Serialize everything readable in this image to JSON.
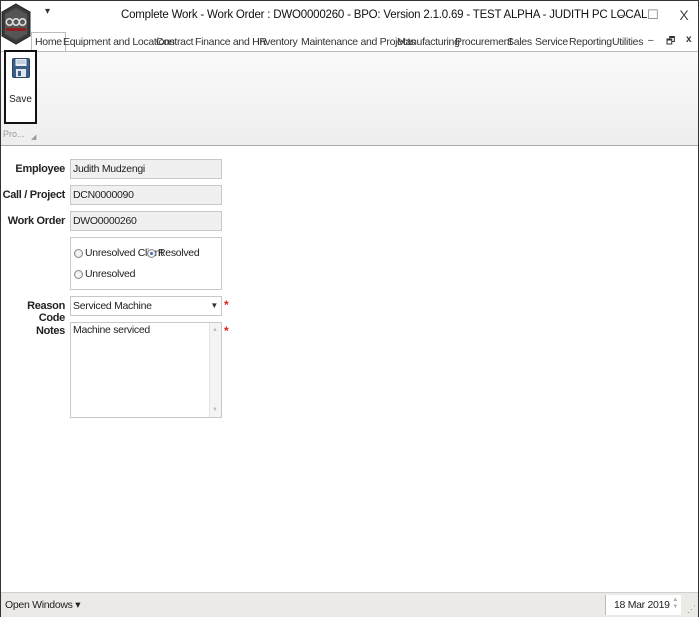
{
  "window": {
    "title": "Complete Work - Work Order : DWO0000260 - BPO: Version 2.1.0.69 - TEST ALPHA - JUDITH PC LOCAL",
    "quick_access": "▾",
    "minimize": "–",
    "restore": "☐",
    "close": "X"
  },
  "ribbon": {
    "tabs": [
      {
        "label": "Home",
        "active": true
      },
      {
        "label": "Equipment and Locations"
      },
      {
        "label": "Contract"
      },
      {
        "label": "Finance and HR"
      },
      {
        "label": "Inventory"
      },
      {
        "label": "Maintenance and Projects"
      },
      {
        "label": "Manufacturing"
      },
      {
        "label": "Procurement"
      },
      {
        "label": "Sales"
      },
      {
        "label": "Service"
      },
      {
        "label": "Reporting"
      },
      {
        "label": "Utilities"
      }
    ],
    "tab_controls": {
      "minimize": "–",
      "restore": "🗗",
      "close": "x"
    },
    "save_label": "Save",
    "group_label": "Pro...",
    "group_launcher": "◢"
  },
  "form": {
    "employee_label": "Employee",
    "employee_value": "Judith Mudzengi",
    "call_label": "Call / Project",
    "call_value": "DCN0000090",
    "work_order_label": "Work Order",
    "work_order_value": "DWO0000260",
    "status_options": [
      {
        "label": "Unresolved Client",
        "selected": false
      },
      {
        "label": "Resolved",
        "selected": true
      },
      {
        "label": "Unresolved",
        "selected": false
      }
    ],
    "reason_label": "Reason Code",
    "reason_value": "Serviced Machine",
    "notes_label": "Notes",
    "notes_value": "Machine serviced",
    "required_marker": "*"
  },
  "statusbar": {
    "open_windows": "Open Windows ▾",
    "date": "18 Mar 2019"
  },
  "colors": {
    "required": "#dd2222",
    "radio_selected": "#3a6fc4",
    "field_readonly_bg": "#f0f0f0"
  }
}
